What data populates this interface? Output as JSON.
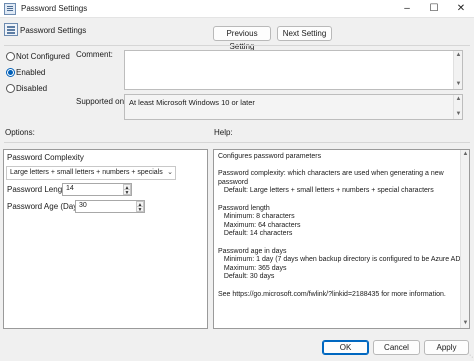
{
  "window": {
    "title": "Password Settings",
    "icon": "policy-icon",
    "controls": [
      "minimize-icon",
      "maximize-icon",
      "close-icon"
    ]
  },
  "header": {
    "title": "Password Settings",
    "previous_setting": "Previous Setting",
    "next_setting": "Next Setting"
  },
  "state": {
    "options": [
      {
        "label": "Not Configured",
        "selected": false
      },
      {
        "label": "Enabled",
        "selected": true
      },
      {
        "label": "Disabled",
        "selected": false
      }
    ]
  },
  "comment": {
    "label": "Comment:",
    "value": ""
  },
  "supported": {
    "label": "Supported on:",
    "value": "At least Microsoft Windows 10 or later"
  },
  "options_panel": {
    "heading": "Options:",
    "complexity_label": "Password Complexity",
    "complexity_value": "Large letters + small letters + numbers + specials",
    "length_label": "Password Length",
    "length_value": "14",
    "age_label": "Password Age (Days)",
    "age_value": "30"
  },
  "help_panel": {
    "heading": "Help:",
    "text": "Configures password parameters\n\nPassword complexity: which characters are used when generating a new password\n   Default: Large letters + small letters + numbers + special characters\n\nPassword length\n   Minimum: 8 characters\n   Maximum: 64 characters\n   Default: 14 characters\n\nPassword age in days\n   Minimum: 1 day (7 days when backup directory is configured to be Azure AD)\n   Maximum: 365 days\n   Default: 30 days\n\nSee https://go.microsoft.com/fwlink/?linkid=2188435 for more information."
  },
  "footer": {
    "ok": "OK",
    "cancel": "Cancel",
    "apply": "Apply"
  },
  "colors": {
    "accent": "#005fb8",
    "background": "#f0f0f0"
  }
}
